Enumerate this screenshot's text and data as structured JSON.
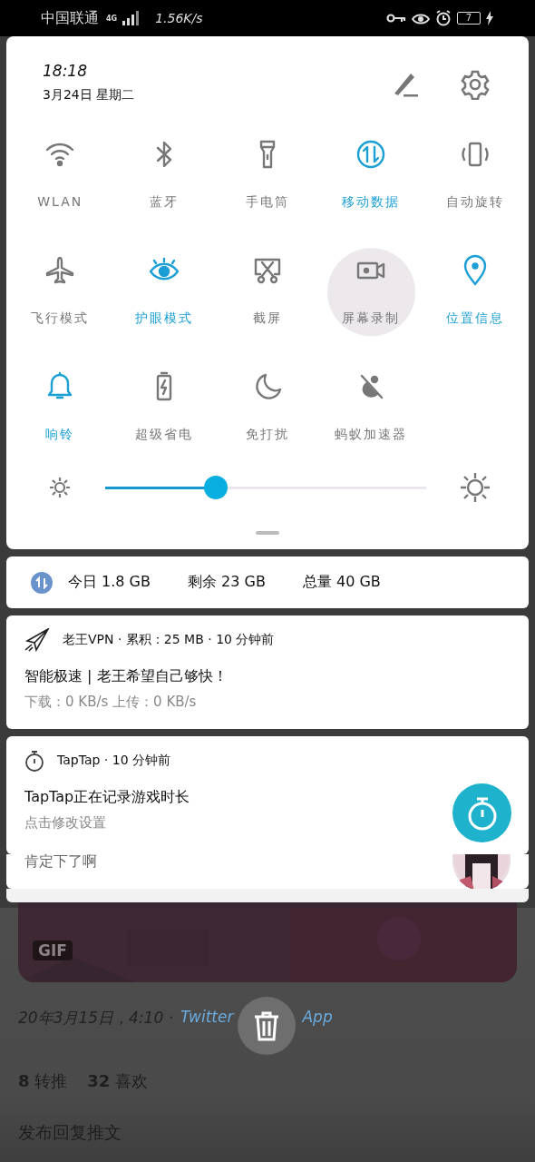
{
  "status_bar": {
    "carrier": "中国联通",
    "network": "4G",
    "speed": "1.56K/s",
    "battery": "7",
    "charging": true
  },
  "quick_settings": {
    "time": "18:18",
    "date": "3月24日 星期二",
    "tiles": [
      {
        "label": "WLAN",
        "on": false,
        "pressed": false
      },
      {
        "label": "蓝牙",
        "on": false,
        "pressed": false
      },
      {
        "label": "手电筒",
        "on": false,
        "pressed": false
      },
      {
        "label": "移动数据",
        "on": true,
        "pressed": false
      },
      {
        "label": "自动旋转",
        "on": false,
        "pressed": false
      },
      {
        "label": "飞行模式",
        "on": false,
        "pressed": false
      },
      {
        "label": "护眼模式",
        "on": true,
        "pressed": false
      },
      {
        "label": "截屏",
        "on": false,
        "pressed": false
      },
      {
        "label": "屏幕录制",
        "on": false,
        "pressed": true
      },
      {
        "label": "位置信息",
        "on": true,
        "pressed": false
      },
      {
        "label": "响铃",
        "on": true,
        "pressed": false
      },
      {
        "label": "超级省电",
        "on": false,
        "pressed": false
      },
      {
        "label": "免打扰",
        "on": false,
        "pressed": false
      },
      {
        "label": "蚂蚁加速器",
        "on": false,
        "pressed": false
      }
    ],
    "brightness": {
      "level": 0.345
    }
  },
  "data_usage": [
    {
      "label": "今日",
      "value": "1.8 GB"
    },
    {
      "label": "剩余",
      "value": "23 GB"
    },
    {
      "label": "总量",
      "value": "40 GB"
    }
  ],
  "notifications": [
    {
      "kind": "vpn",
      "header": "老王VPN · 累积：25 MB · 10 分钟前",
      "title": "智能极速 | 老王希望自己够快！",
      "text": "下载：0 KB/s  上传：0 KB/s"
    },
    {
      "kind": "timer",
      "header": "TapTap · 10 分钟前",
      "title": "TapTap正在记录游戏时长",
      "text": "点击修改设置"
    }
  ],
  "background_notification": {
    "text": "肯定下了啊"
  },
  "tweet": {
    "badge": "GIF",
    "date": "20年3月15日，4:10 ·",
    "source": [
      "Twitter",
      "App"
    ],
    "retweets": "**8** 转推",
    "likes": "**32** 喜欢",
    "reply": "发布回复推文"
  }
}
